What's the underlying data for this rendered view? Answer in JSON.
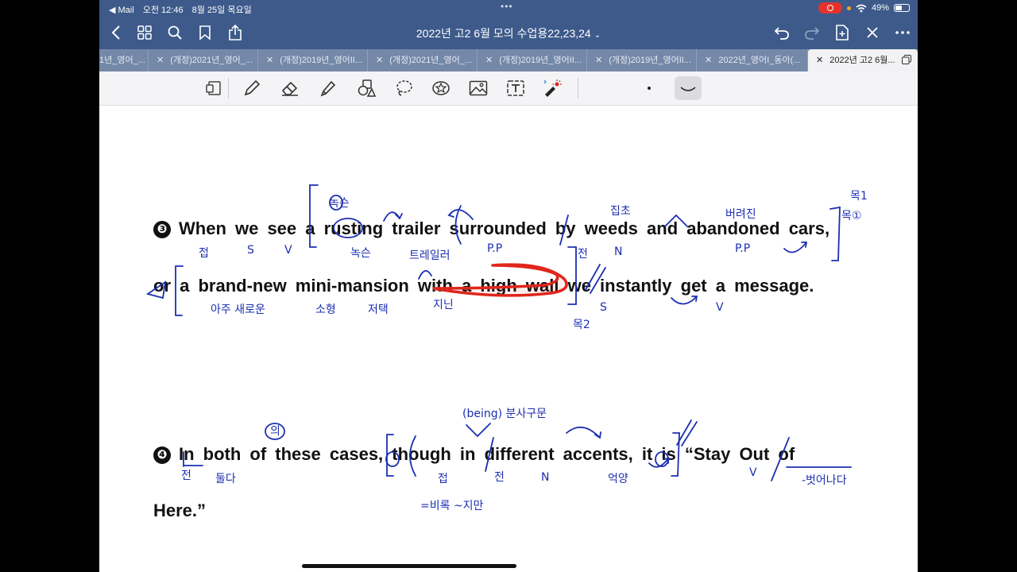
{
  "status": {
    "back_app": "◀ Mail",
    "time": "오전 12:46",
    "date": "8월 25일 목요일",
    "battery": "49%",
    "battery_level": 0.49
  },
  "nav": {
    "title": "2022년 고2 6월 모의 수업용22,23,24"
  },
  "tabs": [
    {
      "label": "1년_영어_..."
    },
    {
      "label": "(개정)2021년_영어_..."
    },
    {
      "label": "(개정)2019년_영어II..."
    },
    {
      "label": "(개정)2021년_영어_..."
    },
    {
      "label": "(개정)2019년_영어II..."
    },
    {
      "label": "(개정)2019년_영어II..."
    },
    {
      "label": "2022년_영어I_동아(..."
    },
    {
      "label": "2022년 고2 6월..."
    }
  ],
  "sentence3": {
    "number": "❸",
    "line1": "When we see a rusting trailer surrounded by weeds and abandoned cars,",
    "line2": "or a brand-new mini-mansion with a high wall we instantly get a message."
  },
  "sentence4": {
    "number": "❹",
    "line1": "In both of these cases, though in different accents, it is “Stay Out of",
    "line2": "Here.”"
  },
  "annotations": {
    "a1": "목1",
    "a2": "녹슨",
    "a3": "집초",
    "a4": "버려진",
    "a5": "목①",
    "a6": "접",
    "a7": "S",
    "a8": "V",
    "a9": "녹슨",
    "a10": "트레일러",
    "a11": "P.P",
    "a12": "전",
    "a13": "N",
    "a14": "P.P",
    "a15": "아주 새로운",
    "a16": "소형",
    "a17": "저택",
    "a18": "지닌",
    "a19": "목2",
    "a20": "S",
    "a21": "V",
    "a22": "(being) 분사구문",
    "a23": "의",
    "a24": "전",
    "a25": "둘다",
    "a26": "접",
    "a27": "전",
    "a28": "N",
    "a29": "억양",
    "a30": "V",
    "a31": "-벗어나다",
    "a32": "=비록 ~지만"
  },
  "colors": {
    "chrome": "#3d5a8a",
    "tab_bar": "#7488a8",
    "pen_ink": "#1c2fb0",
    "highlight_red": "#e0261c"
  }
}
